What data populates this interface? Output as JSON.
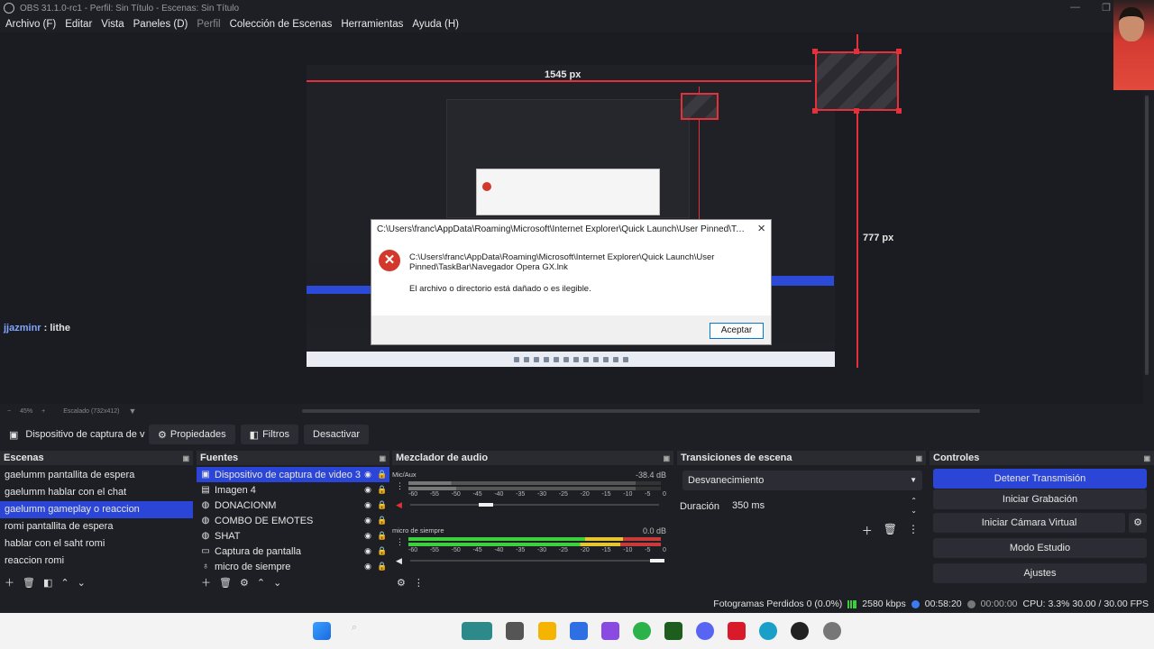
{
  "window": {
    "title": "OBS 31.1.0-rc1 - Perfil: Sin Título - Escenas: Sin Título"
  },
  "menu": {
    "items": [
      "Archivo (F)",
      "Editar",
      "Vista",
      "Paneles (D)",
      "Perfil",
      "Colección de Escenas",
      "Herramientas",
      "Ayuda (H)"
    ]
  },
  "preview": {
    "width_label": "1545 px",
    "height_label": "777 px",
    "zoom": "45%",
    "scaled": "Escalado (732x412)",
    "chat_user": "jjazminr",
    "chat_sep": " : ",
    "chat_msg": "lithe"
  },
  "error_dialog": {
    "title": "C:\\Users\\franc\\AppData\\Roaming\\Microsoft\\Internet Explorer\\Quick Launch\\User Pinned\\TaskB...",
    "path": "C:\\Users\\franc\\AppData\\Roaming\\Microsoft\\Internet Explorer\\Quick Launch\\User Pinned\\TaskBar\\Navegador Opera GX.lnk",
    "message": "El archivo o directorio está dañado o es ilegible.",
    "ok_label": "Aceptar"
  },
  "source_bar": {
    "selected_source": "Dispositivo de captura de v",
    "properties": "Propiedades",
    "filters": "Filtros",
    "deactivate": "Desactivar"
  },
  "scenes": {
    "title": "Escenas",
    "items": [
      {
        "label": "gaelumm pantallita de espera",
        "selected": false
      },
      {
        "label": "gaelumm hablar con el chat",
        "selected": false
      },
      {
        "label": "gaelumm gameplay o reaccion",
        "selected": true
      },
      {
        "label": "romi pantallita de espera",
        "selected": false
      },
      {
        "label": "hablar con el saht romi",
        "selected": false
      },
      {
        "label": "reaccion romi",
        "selected": false
      }
    ]
  },
  "sources": {
    "title": "Fuentes",
    "items": [
      {
        "label": "Dispositivo de captura de video 3",
        "icon": "camera-icon",
        "selected": true
      },
      {
        "label": "Imagen 4",
        "icon": "image-icon",
        "selected": false
      },
      {
        "label": "DONACIONM",
        "icon": "globe-icon",
        "selected": false
      },
      {
        "label": "COMBO DE EMOTES",
        "icon": "globe-icon",
        "selected": false
      },
      {
        "label": "SHAT",
        "icon": "globe-icon",
        "selected": false
      },
      {
        "label": "Captura de pantalla",
        "icon": "monitor-icon",
        "selected": false
      },
      {
        "label": "micro de siempre",
        "icon": "microphone-icon",
        "selected": false
      }
    ]
  },
  "mixer": {
    "title": "Mezclador de audio",
    "scale": [
      "-60",
      "-55",
      "-50",
      "-45",
      "-40",
      "-35",
      "-30",
      "-25",
      "-20",
      "-15",
      "-10",
      "-5",
      "0"
    ],
    "channels": [
      {
        "name": "Mic/Aux",
        "db": "-38.4 dB",
        "muted": true
      },
      {
        "name": "micro de siempre",
        "db": "0.0 dB",
        "muted": false
      }
    ]
  },
  "transitions": {
    "title": "Transiciones de escena",
    "selected": "Desvanecimiento",
    "duration_label": "Duración",
    "duration_value": "350 ms"
  },
  "controls": {
    "title": "Controles",
    "stop_stream": "Detener Transmisión",
    "start_recording": "Iniciar Grabación",
    "virtual_cam": "Iniciar Cámara Virtual",
    "studio_mode": "Modo Estudio",
    "settings": "Ajustes"
  },
  "status": {
    "dropped": "Fotogramas Perdidos 0 (0.0%)",
    "bitrate": "2580 kbps",
    "stream_time": "00:58:20",
    "rec_time": "00:00:00",
    "cpu": "CPU: 3.3% 30.00 / 30.00 FPS"
  },
  "colors": {
    "accent": "#2b46d6",
    "selection_red": "#e3303a",
    "panel_bg": "#1e1f24"
  }
}
